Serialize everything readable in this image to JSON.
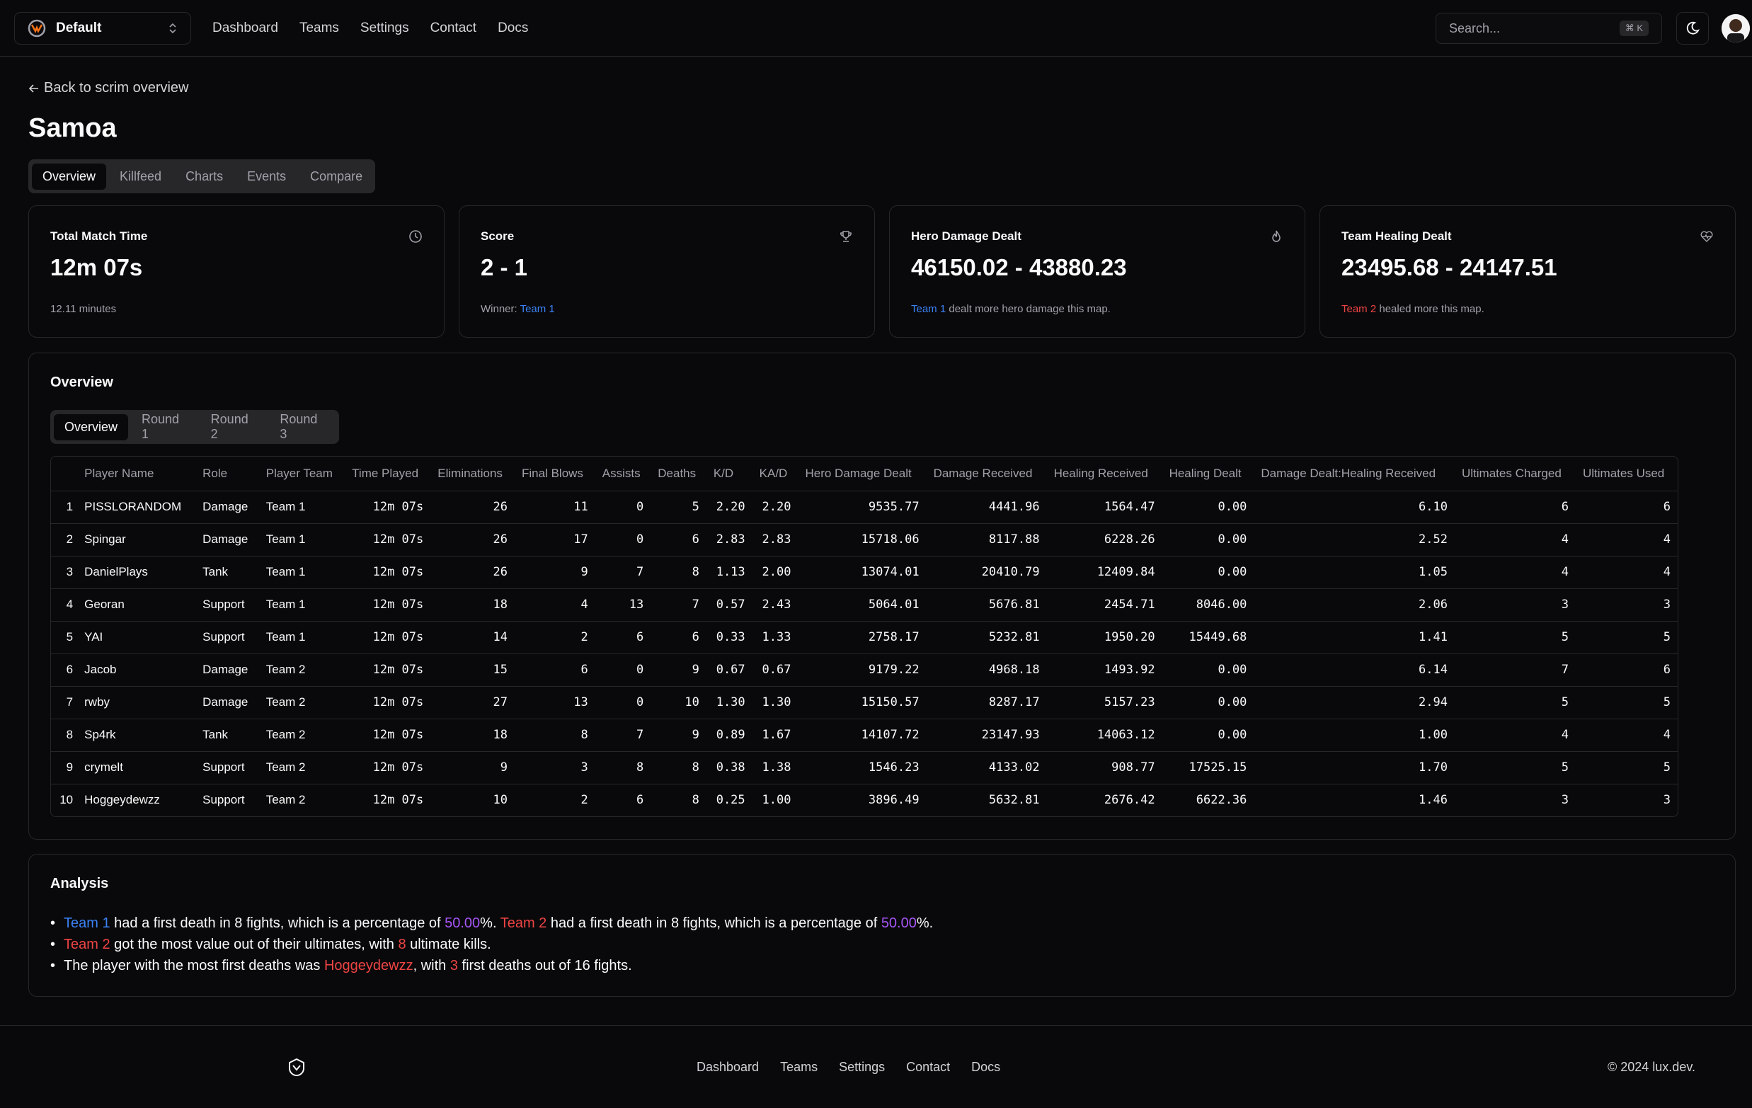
{
  "header": {
    "team_name": "Default",
    "nav": [
      "Dashboard",
      "Teams",
      "Settings",
      "Contact",
      "Docs"
    ],
    "search_placeholder": "Search...",
    "search_shortcut": "⌘ K"
  },
  "page": {
    "back_label": "Back to scrim overview",
    "title": "Samoa",
    "tabs": [
      "Overview",
      "Killfeed",
      "Charts",
      "Events",
      "Compare"
    ],
    "active_tab": "Overview"
  },
  "stats": [
    {
      "label": "Total Match Time",
      "value": "12m 07s",
      "sub": "12.11 minutes",
      "icon": "clock-icon"
    },
    {
      "label": "Score",
      "value": "2 - 1",
      "sub_prefix": "Winner: ",
      "sub_team": "Team 1",
      "icon": "trophy-icon"
    },
    {
      "label": "Hero Damage Dealt",
      "value": "46150.02 - 43880.23",
      "sub_team": "Team 1",
      "sub_suffix": " dealt more hero damage this map.",
      "icon": "flame-icon"
    },
    {
      "label": "Team Healing Dealt",
      "value": "23495.68 - 24147.51",
      "sub_team": "Team 2",
      "sub_suffix": " healed more this map.",
      "icon": "heart-pulse-icon"
    }
  ],
  "overview": {
    "title": "Overview",
    "round_tabs": [
      "Overview",
      "Round 1",
      "Round 2",
      "Round 3"
    ],
    "columns": [
      "Player Name",
      "Role",
      "Player Team",
      "Time Played",
      "Eliminations",
      "Final Blows",
      "Assists",
      "Deaths",
      "K/D",
      "KA/D",
      "Hero Damage Dealt",
      "Damage Received",
      "Healing Received",
      "Healing Dealt",
      "Damage Dealt:Healing Received",
      "Ultimates Charged",
      "Ultimates Used"
    ],
    "rows": [
      [
        "1",
        "PISSLORANDOM",
        "Damage",
        "Team 1",
        "12m 07s",
        "26",
        "11",
        "0",
        "5",
        "2.20",
        "2.20",
        "9535.77",
        "4441.96",
        "1564.47",
        "0.00",
        "6.10",
        "6",
        "6"
      ],
      [
        "2",
        "Spingar",
        "Damage",
        "Team 1",
        "12m 07s",
        "26",
        "17",
        "0",
        "6",
        "2.83",
        "2.83",
        "15718.06",
        "8117.88",
        "6228.26",
        "0.00",
        "2.52",
        "4",
        "4"
      ],
      [
        "3",
        "DanielPlays",
        "Tank",
        "Team 1",
        "12m 07s",
        "26",
        "9",
        "7",
        "8",
        "1.13",
        "2.00",
        "13074.01",
        "20410.79",
        "12409.84",
        "0.00",
        "1.05",
        "4",
        "4"
      ],
      [
        "4",
        "Georan",
        "Support",
        "Team 1",
        "12m 07s",
        "18",
        "4",
        "13",
        "7",
        "0.57",
        "2.43",
        "5064.01",
        "5676.81",
        "2454.71",
        "8046.00",
        "2.06",
        "3",
        "3"
      ],
      [
        "5",
        "YAI",
        "Support",
        "Team 1",
        "12m 07s",
        "14",
        "2",
        "6",
        "6",
        "0.33",
        "1.33",
        "2758.17",
        "5232.81",
        "1950.20",
        "15449.68",
        "1.41",
        "5",
        "5"
      ],
      [
        "6",
        "Jacob",
        "Damage",
        "Team 2",
        "12m 07s",
        "15",
        "6",
        "0",
        "9",
        "0.67",
        "0.67",
        "9179.22",
        "4968.18",
        "1493.92",
        "0.00",
        "6.14",
        "7",
        "6"
      ],
      [
        "7",
        "rwby",
        "Damage",
        "Team 2",
        "12m 07s",
        "27",
        "13",
        "0",
        "10",
        "1.30",
        "1.30",
        "15150.57",
        "8287.17",
        "5157.23",
        "0.00",
        "2.94",
        "5",
        "5"
      ],
      [
        "8",
        "Sp4rk",
        "Tank",
        "Team 2",
        "12m 07s",
        "18",
        "8",
        "7",
        "9",
        "0.89",
        "1.67",
        "14107.72",
        "23147.93",
        "14063.12",
        "0.00",
        "1.00",
        "4",
        "4"
      ],
      [
        "9",
        "crymelt",
        "Support",
        "Team 2",
        "12m 07s",
        "9",
        "3",
        "8",
        "8",
        "0.38",
        "1.38",
        "1546.23",
        "4133.02",
        "908.77",
        "17525.15",
        "1.70",
        "5",
        "5"
      ],
      [
        "10",
        "Hoggeydewzz",
        "Support",
        "Team 2",
        "12m 07s",
        "10",
        "2",
        "6",
        "8",
        "0.25",
        "1.00",
        "3896.49",
        "5632.81",
        "2676.42",
        "6622.36",
        "1.46",
        "3",
        "3"
      ]
    ]
  },
  "analysis": {
    "title": "Analysis",
    "line1": {
      "team_a": "Team 1",
      "text_a": " had a first death in 8 fights, which is a percentage of ",
      "pct_a": "50.00",
      "pct_suffix_a": "%. ",
      "team_b": "Team 2",
      "text_b": " had a first death in 8 fights, which is a percentage of ",
      "pct_b": "50.00",
      "pct_suffix_b": "%."
    },
    "line2": {
      "team": "Team 2",
      "text_a": " got the most value out of their ultimates, with ",
      "count": "8",
      "text_b": " ultimate kills."
    },
    "line3": {
      "text_a": "The player with the most first deaths was ",
      "player": "Hoggeydewzz",
      "text_b": ", with ",
      "count": "3",
      "text_c": " first deaths out of 16 fights."
    }
  },
  "footer": {
    "nav": [
      "Dashboard",
      "Teams",
      "Settings",
      "Contact",
      "Docs"
    ],
    "copyright": "© 2024 lux.dev."
  },
  "colors": {
    "background": "#09090b",
    "border": "#27272a",
    "team1": "#3b82f6",
    "team2": "#ef4444",
    "highlight": "#a855f7"
  }
}
